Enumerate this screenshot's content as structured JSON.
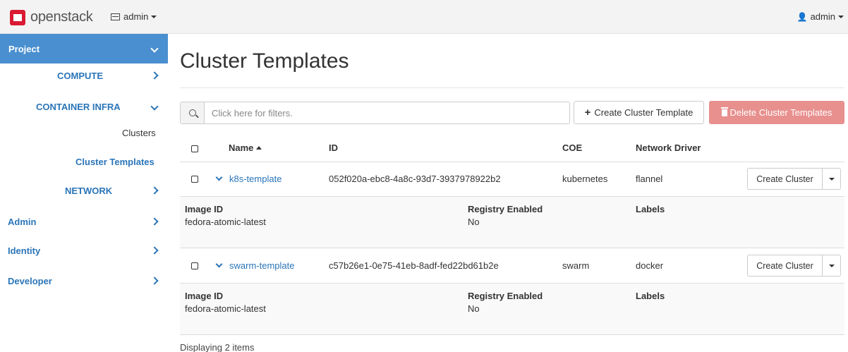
{
  "navbar": {
    "brand": "openstack",
    "project_menu": "admin",
    "user_menu": "admin"
  },
  "sidebar": {
    "project": "Project",
    "compute": "COMPUTE",
    "container_infra": "CONTAINER INFRA",
    "clusters": "Clusters",
    "cluster_templates": "Cluster Templates",
    "network": "NETWORK",
    "admin": "Admin",
    "identity": "Identity",
    "developer": "Developer"
  },
  "main": {
    "title": "Cluster Templates",
    "filter_placeholder": "Click here for filters.",
    "create_label": "Create Cluster Template",
    "delete_label": "Delete Cluster Templates"
  },
  "table": {
    "headers": {
      "name": "Name",
      "id": "ID",
      "coe": "COE",
      "network_driver": "Network Driver"
    },
    "detail_labels": {
      "image_id": "Image ID",
      "registry_enabled": "Registry Enabled",
      "labels": "Labels"
    },
    "row_action": "Create Cluster",
    "rows": [
      {
        "name": "k8s-template",
        "id": "052f020a-ebc8-4a8c-93d7-3937978922b2",
        "coe": "kubernetes",
        "network_driver": "flannel",
        "image_id": "fedora-atomic-latest",
        "registry_enabled": "No"
      },
      {
        "name": "swarm-template",
        "id": "c57b26e1-0e75-41eb-8adf-fed22bd61b2e",
        "coe": "swarm",
        "network_driver": "docker",
        "image_id": "fedora-atomic-latest",
        "registry_enabled": "No"
      }
    ],
    "footer": "Displaying 2 items"
  },
  "colors": {
    "primary": "#4a8fd0",
    "link": "#2a75b8",
    "danger_disabled": "#e7908e",
    "brand_red": "#da1a32"
  }
}
